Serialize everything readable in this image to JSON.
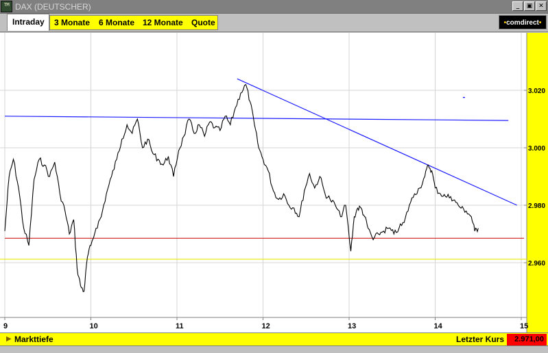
{
  "window": {
    "icon_text": "TM",
    "title": "DAX (DEUTSCHER)",
    "controls": [
      "_",
      "▣",
      "✕"
    ]
  },
  "tabs": {
    "active": "Intraday",
    "items": [
      "3 Monate",
      "6 Monate",
      "12 Monate",
      "Quote"
    ]
  },
  "logo": {
    "prefix": "•",
    "text": "comdirect",
    "suffix": "•"
  },
  "bottom": {
    "markttiefe_label": "Markttiefe",
    "letzter_kurs_label": "Letzter Kurs",
    "letzter_kurs_value": "2.971,00"
  },
  "colors": {
    "yellow": "#ffff00",
    "price_line": "#000000",
    "trend_line": "#1a1aff",
    "support_red": "#cc0000",
    "support_yellow": "#e8e800",
    "last_price_bg": "#ff0000"
  },
  "chart_data": {
    "type": "line",
    "series_color": "#000000",
    "x_ticks": [
      "9",
      "10",
      "11",
      "12",
      "13",
      "14",
      "15"
    ],
    "y_ticks": [
      "3.020",
      "3.000",
      "2.980",
      "2.960"
    ],
    "ylim": [
      2945,
      3042
    ],
    "xlim": [
      9,
      15
    ],
    "grid": true,
    "x": [
      9.0,
      9.05,
      9.1,
      9.16,
      9.22,
      9.28,
      9.34,
      9.4,
      9.46,
      9.52,
      9.58,
      9.64,
      9.7,
      9.75,
      9.8,
      9.84,
      9.88,
      9.92,
      9.96,
      10.0,
      10.06,
      10.12,
      10.18,
      10.24,
      10.3,
      10.36,
      10.42,
      10.48,
      10.54,
      10.6,
      10.66,
      10.72,
      10.78,
      10.84,
      10.9,
      10.96,
      11.02,
      11.08,
      11.14,
      11.2,
      11.26,
      11.32,
      11.38,
      11.44,
      11.5,
      11.56,
      11.62,
      11.68,
      11.74,
      11.8,
      11.85,
      11.9,
      11.95,
      12.0,
      12.06,
      12.12,
      12.18,
      12.24,
      12.3,
      12.36,
      12.42,
      12.48,
      12.54,
      12.6,
      12.66,
      12.72,
      12.78,
      12.84,
      12.9,
      12.96,
      13.02,
      13.06,
      13.1,
      13.14,
      13.18,
      13.22,
      13.28,
      13.34,
      13.4,
      13.46,
      13.52,
      13.58,
      13.64,
      13.7,
      13.76,
      13.82,
      13.88,
      13.92,
      13.96,
      14.0,
      14.06,
      14.12,
      14.18,
      14.24,
      14.3,
      14.36,
      14.42,
      14.46,
      14.5
    ],
    "values": [
      2971,
      2990,
      2996,
      2986,
      2972,
      2966,
      2989,
      2996,
      2994,
      2990,
      2995,
      2984,
      2978,
      2970,
      2975,
      2958,
      2952,
      2950,
      2962,
      2966,
      2972,
      2976,
      2984,
      2990,
      2996,
      3003,
      3008,
      3005,
      3010,
      3000,
      3003,
      2998,
      2996,
      2994,
      2997,
      2990,
      2999,
      3004,
      3010,
      3005,
      3008,
      3004,
      3009,
      3007,
      3006,
      3011,
      3008,
      3014,
      3019,
      3022,
      3016,
      3008,
      3000,
      2996,
      2992,
      2985,
      2982,
      2984,
      2980,
      2979,
      2976,
      2985,
      2991,
      2986,
      2990,
      2984,
      2982,
      2980,
      2976,
      2980,
      2964,
      2976,
      2979,
      2979,
      2976,
      2972,
      2968,
      2970,
      2971,
      2972,
      2970,
      2972,
      2974,
      2980,
      2984,
      2986,
      2990,
      2994,
      2992,
      2986,
      2984,
      2983,
      2983,
      2981,
      2979,
      2978,
      2976,
      2971,
      2972
    ],
    "overlays": {
      "horizontal_resistance": [
        [
          9.0,
          3011.0
        ],
        [
          14.85,
          3009.5
        ]
      ],
      "falling_trendline": [
        [
          11.7,
          3024.0
        ],
        [
          14.95,
          2980.0
        ]
      ],
      "support_red": 2968.5,
      "support_yellow": 2961.2,
      "marker": [
        14.33,
        3017.5
      ]
    }
  }
}
